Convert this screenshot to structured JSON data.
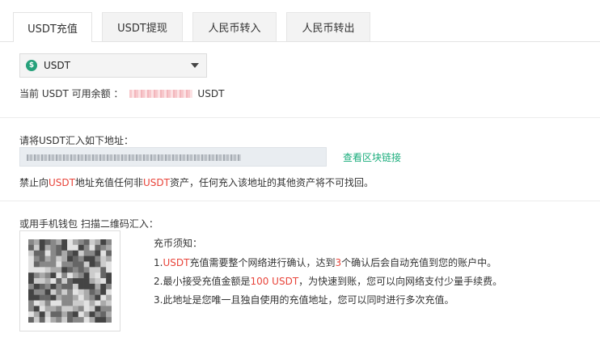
{
  "tabs": [
    {
      "label": "USDT充值",
      "active": true
    },
    {
      "label": "USDT提现",
      "active": false
    },
    {
      "label": "人民币转入",
      "active": false
    },
    {
      "label": "人民币转出",
      "active": false
    }
  ],
  "coin_select": {
    "icon": "usdt-coin-icon",
    "symbol": "$",
    "value": "USDT"
  },
  "balance": {
    "label": "当前 USDT 可用余额 ：",
    "unit": "USDT"
  },
  "deposit": {
    "address_label": "请将USDT汇入如下地址：",
    "chain_link": "查看区块链接",
    "warning": {
      "p1": "禁止向",
      "c1": "USDT",
      "p2": "地址充值任何非",
      "c2": "USDT",
      "p3": "资产，任何充入该地址的其他资产将不可找回。"
    }
  },
  "qr": {
    "label": "或用手机钱包 扫描二维码汇入："
  },
  "notes": {
    "title": "充币须知：",
    "item1": {
      "a": "1.",
      "b": "USDT",
      "c": "充值需要整个网络进行确认，达到",
      "d": "3",
      "e": "个确认后会自动充值到您的账户中。"
    },
    "item2": {
      "a": "2.最小接受充值金额是",
      "b": "100 USDT",
      "c": "，为快速到账，您可以向网络支付少量手续费。"
    },
    "item3": "3.此地址是您唯一且独自使用的充值地址，您可以同时进行多次充值。"
  },
  "colors": {
    "accent_green": "#1aad7c",
    "warn_red": "#e8443a",
    "usdt_green": "#26a17b"
  }
}
